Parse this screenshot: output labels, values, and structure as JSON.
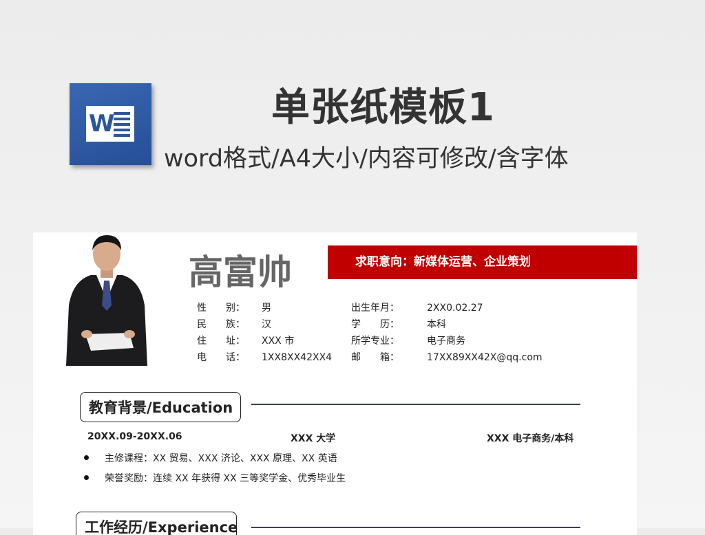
{
  "hero": {
    "icon_letter": "W",
    "title": "单张纸模板1",
    "subtitle": "word格式/A4大小/内容可修改/含字体"
  },
  "resume": {
    "name": "高富帅",
    "job_intention": "求职意向：新媒体运营、企业策划",
    "info_left": [
      {
        "label": "性　　别：",
        "value": "男"
      },
      {
        "label": "民　　族：",
        "value": "汉"
      },
      {
        "label": "住　　址：",
        "value": "XXX 市"
      },
      {
        "label": "电　　话：",
        "value": "1XX8XX42XX4"
      }
    ],
    "info_right": [
      {
        "label": "出生年月：",
        "value": "2XX0.02.27"
      },
      {
        "label": "学　　历：",
        "value": "本科"
      },
      {
        "label": "所学专业：",
        "value": "电子商务"
      },
      {
        "label": "邮　　箱：",
        "value": "17XX89XX42X@qq.com"
      }
    ],
    "education": {
      "heading": "教育背景/Education",
      "period": "20XX.09-20XX.06",
      "school": "XXX 大学",
      "major": "XXX 电子商务/本科",
      "bullets": [
        "主修课程：XX 贸易、XXX 济论、XXX 原理、XX 英语",
        "荣誉奖励：连续 XX 年获得 XX 三等奖学金、优秀毕业生"
      ]
    },
    "experience": {
      "heading": "工作经历/Experience"
    }
  },
  "colors": {
    "accent_red": "#c00000",
    "word_blue": "#2b579a"
  }
}
